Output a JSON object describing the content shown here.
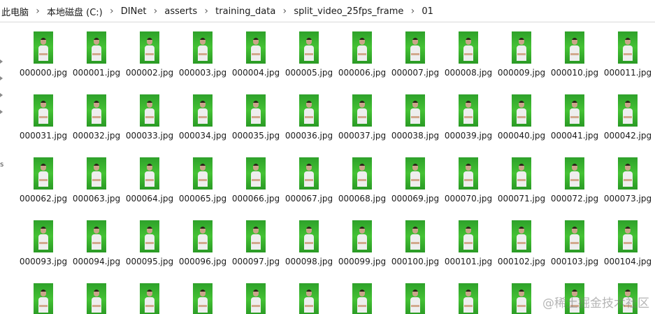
{
  "breadcrumb": {
    "items": [
      "此电脑",
      "本地磁盘 (C:)",
      "DINet",
      "asserts",
      "training_data",
      "split_video_25fps_frame",
      "01"
    ]
  },
  "rows": [
    [
      "000000.jpg",
      "000001.jpg",
      "000002.jpg",
      "000003.jpg",
      "000004.jpg",
      "000005.jpg",
      "000006.jpg",
      "000007.jpg",
      "000008.jpg",
      "000009.jpg",
      "000010.jpg",
      "000011.jpg"
    ],
    [
      "000031.jpg",
      "000032.jpg",
      "000033.jpg",
      "000034.jpg",
      "000035.jpg",
      "000036.jpg",
      "000037.jpg",
      "000038.jpg",
      "000039.jpg",
      "000040.jpg",
      "000041.jpg",
      "000042.jpg"
    ],
    [
      "000062.jpg",
      "000063.jpg",
      "000064.jpg",
      "000065.jpg",
      "000066.jpg",
      "000067.jpg",
      "000068.jpg",
      "000069.jpg",
      "000070.jpg",
      "000071.jpg",
      "000072.jpg",
      "000073.jpg"
    ],
    [
      "000093.jpg",
      "000094.jpg",
      "000095.jpg",
      "000096.jpg",
      "000097.jpg",
      "000098.jpg",
      "000099.jpg",
      "000100.jpg",
      "000101.jpg",
      "000102.jpg",
      "000103.jpg",
      "000104.jpg"
    ]
  ],
  "nav_fragment": "s",
  "watermark": "@稀土掘金技术社区",
  "colors": {
    "thumbnail_background": "#3cb331",
    "text": "#1a1a1a"
  }
}
